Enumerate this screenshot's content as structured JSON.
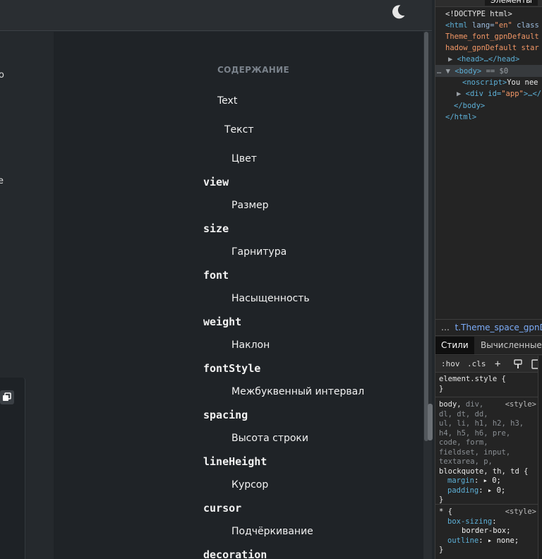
{
  "app": {
    "theme_icon": "moon-icon",
    "left_fragments": [
      "о",
      "е"
    ],
    "copy_icon": "copy-icon"
  },
  "toc": {
    "heading": "СОДЕРЖАНИЕ",
    "items": [
      {
        "label": "Text",
        "kind": "link"
      },
      {
        "label": "Текст",
        "kind": "link"
      },
      {
        "label": "Цвет",
        "kind": "link"
      },
      {
        "label": "view",
        "kind": "code"
      },
      {
        "label": "Размер",
        "kind": "link"
      },
      {
        "label": "size",
        "kind": "code"
      },
      {
        "label": "Гарнитура",
        "kind": "link"
      },
      {
        "label": "font",
        "kind": "code"
      },
      {
        "label": "Насыщенность",
        "kind": "link"
      },
      {
        "label": "weight",
        "kind": "code"
      },
      {
        "label": "Наклон",
        "kind": "link"
      },
      {
        "label": "fontStyle",
        "kind": "code"
      },
      {
        "label": "Межбуквенный интервал",
        "kind": "link"
      },
      {
        "label": "spacing",
        "kind": "code"
      },
      {
        "label": "Высота строки",
        "kind": "link"
      },
      {
        "label": "lineHeight",
        "kind": "code"
      },
      {
        "label": "Курсор",
        "kind": "link"
      },
      {
        "label": "cursor",
        "kind": "code"
      },
      {
        "label": "Подчёркивание",
        "kind": "link"
      },
      {
        "label": "decoration",
        "kind": "code"
      }
    ]
  },
  "devtools": {
    "elements_tab": "Элементы",
    "dom": {
      "doctype": "<!DOCTYPE html>",
      "html_open_tag": "<html",
      "html_lang_attr": " lang=",
      "html_lang_val": "\"en\"",
      "html_class_attr": " class",
      "html_class_line2": "Theme_font_gpnDefault",
      "html_class_line3": "hadow_gpnDefault star",
      "head": "<head>…</head>",
      "body_open": "<body>",
      "body_marker": " == $0",
      "noscript_tag": "<noscript>",
      "noscript_text": "You nee",
      "div_open": "<div id=",
      "div_id": "\"app\"",
      "div_close": ">…</",
      "body_close": "</body>",
      "html_close": "</html>"
    },
    "breadcrumb": "t.Theme_space_gpnDe",
    "breadcrumb_ellipsis": "…",
    "tabs": [
      "Стили",
      "Вычисленные"
    ],
    "filter": {
      "hov": ":hov",
      "cls": ".cls",
      "add": "+"
    },
    "rules": {
      "element_style": "element.style {",
      "close_brace": "}",
      "reset_selector_main": "body,",
      "reset_selector_rest": [
        " div,",
        "dl, dt, dd,",
        "ul, li, h1, h2, h3,",
        "h4, h5, h6, pre,",
        "code, form,",
        "fieldset, input,",
        "textarea, p,",
        "blockquote, th, td {"
      ],
      "reset_source": "<style>",
      "reset_props": [
        {
          "name": "margin",
          "value": "0;"
        },
        {
          "name": "padding",
          "value": "0;"
        }
      ],
      "universal_selector": "* {",
      "universal_source": "<style>",
      "universal_props": [
        {
          "name": "box-sizing",
          "value": "border-box;"
        },
        {
          "name": "outline",
          "value": "none;"
        }
      ]
    }
  }
}
